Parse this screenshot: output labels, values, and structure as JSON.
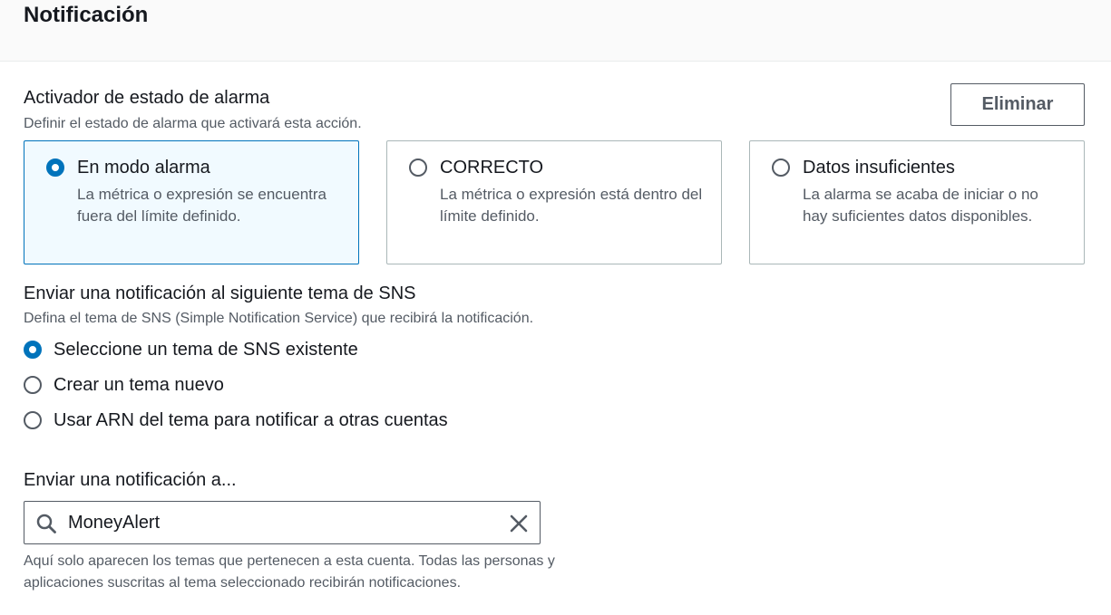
{
  "header": {
    "title": "Notificación"
  },
  "alarm_state": {
    "title": "Activador de estado de alarma",
    "description": "Definir el estado de alarma que activará esta acción.",
    "delete_label": "Eliminar",
    "options": [
      {
        "label": "En modo alarma",
        "description": "La métrica o expresión se encuentra fuera del límite definido.",
        "selected": true
      },
      {
        "label": "CORRECTO",
        "description": "La métrica o expresión está dentro del límite definido.",
        "selected": false
      },
      {
        "label": "Datos insuficientes",
        "description": "La alarma se acaba de iniciar o no hay suficientes datos disponibles.",
        "selected": false
      }
    ]
  },
  "sns": {
    "title": "Enviar una notificación al siguiente tema de SNS",
    "description": "Defina el tema de SNS (Simple Notification Service) que recibirá la notificación.",
    "options": [
      {
        "label": "Seleccione un tema de SNS existente",
        "selected": true
      },
      {
        "label": "Crear un tema nuevo",
        "selected": false
      },
      {
        "label": "Usar ARN del tema para notificar a otras cuentas",
        "selected": false
      }
    ]
  },
  "send_to": {
    "label": "Enviar una notificación a...",
    "value": "MoneyAlert",
    "hint": "Aquí solo aparecen los temas que pertenecen a esta cuenta. Todas las personas y aplicaciones suscritas al tema seleccionado recibirán notificaciones."
  },
  "colors": {
    "accent": "#0073bb",
    "selected_bg": "#f1faff",
    "text": "#16191f",
    "muted": "#545b64"
  },
  "icons": {
    "search": "search-icon",
    "clear": "close-icon"
  }
}
